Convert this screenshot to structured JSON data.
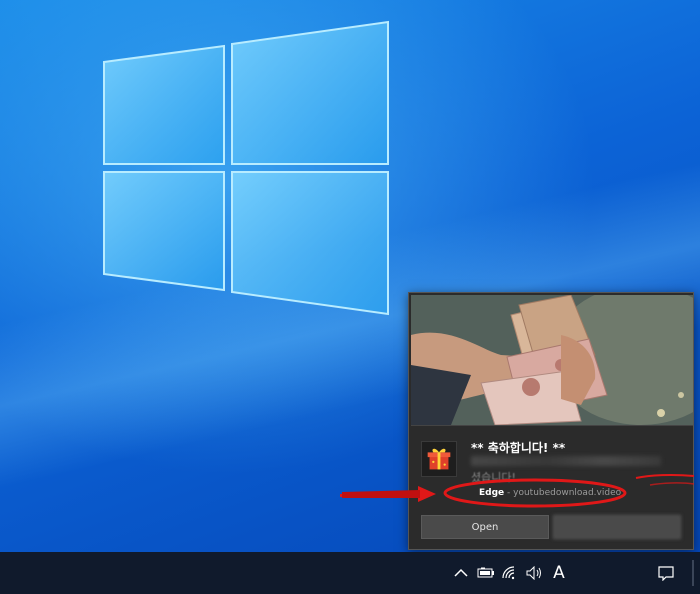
{
  "desktop": {
    "wallpaper": "windows-10-hero-wallpaper",
    "accent_color": "#0c63d6"
  },
  "notification": {
    "title": "** 축하합니다! **",
    "body": "셨습니다!",
    "app_name": "Edge",
    "separator": " - ",
    "site": "youtubedownload.video",
    "open_label": "Open",
    "image": "banknotes-in-hand-photo",
    "icon": "gift-box-icon"
  },
  "taskbar": {
    "ime_indicator": "A",
    "icons": [
      "chevron-up-icon",
      "battery-icon",
      "wifi-icon",
      "volume-icon",
      "action-center-icon"
    ]
  },
  "annotation": {
    "color": "#e01818"
  }
}
